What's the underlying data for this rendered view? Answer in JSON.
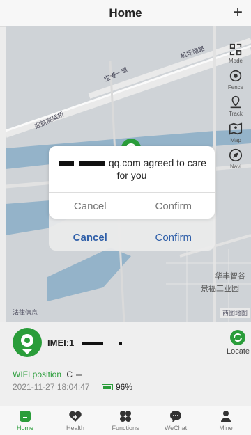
{
  "header": {
    "title": "Home",
    "add_label": "+"
  },
  "map": {
    "tools": [
      {
        "label": "Mode",
        "icon": "mode-icon"
      },
      {
        "label": "Fence",
        "icon": "fence-icon"
      },
      {
        "label": "Track",
        "icon": "track-icon"
      },
      {
        "label": "Map",
        "icon": "map-icon"
      },
      {
        "label": "Navi",
        "icon": "navi-icon"
      }
    ],
    "labels": {
      "road1": "空港一道",
      "road2": "机场南路",
      "road3": "迎航高架桥",
      "area1": "华丰智谷",
      "area2": "景福工业园"
    },
    "logo_left": "法律信息",
    "logo_right": "西图地图"
  },
  "dialog": {
    "message_suffix": "qq.com agreed to care for you",
    "cancel": "Cancel",
    "confirm": "Confirm"
  },
  "dialog_back": {
    "cancel": "Cancel",
    "confirm": "Confirm"
  },
  "device": {
    "imei_label": "IMEI:1",
    "locate_label": "Locate",
    "wifi_label": "WIFI position",
    "wifi_extra": "C",
    "timestamp": "2021-11-27 18:04:47",
    "battery": "96%"
  },
  "tabs": [
    {
      "label": "Home",
      "icon": "home-icon",
      "active": true
    },
    {
      "label": "Health",
      "icon": "health-icon"
    },
    {
      "label": "Functions",
      "icon": "functions-icon"
    },
    {
      "label": "WeChat",
      "icon": "wechat-icon"
    },
    {
      "label": "Mine",
      "icon": "mine-icon"
    }
  ],
  "colors": {
    "accent": "#2a9d3a",
    "link": "#2e5ea8"
  }
}
